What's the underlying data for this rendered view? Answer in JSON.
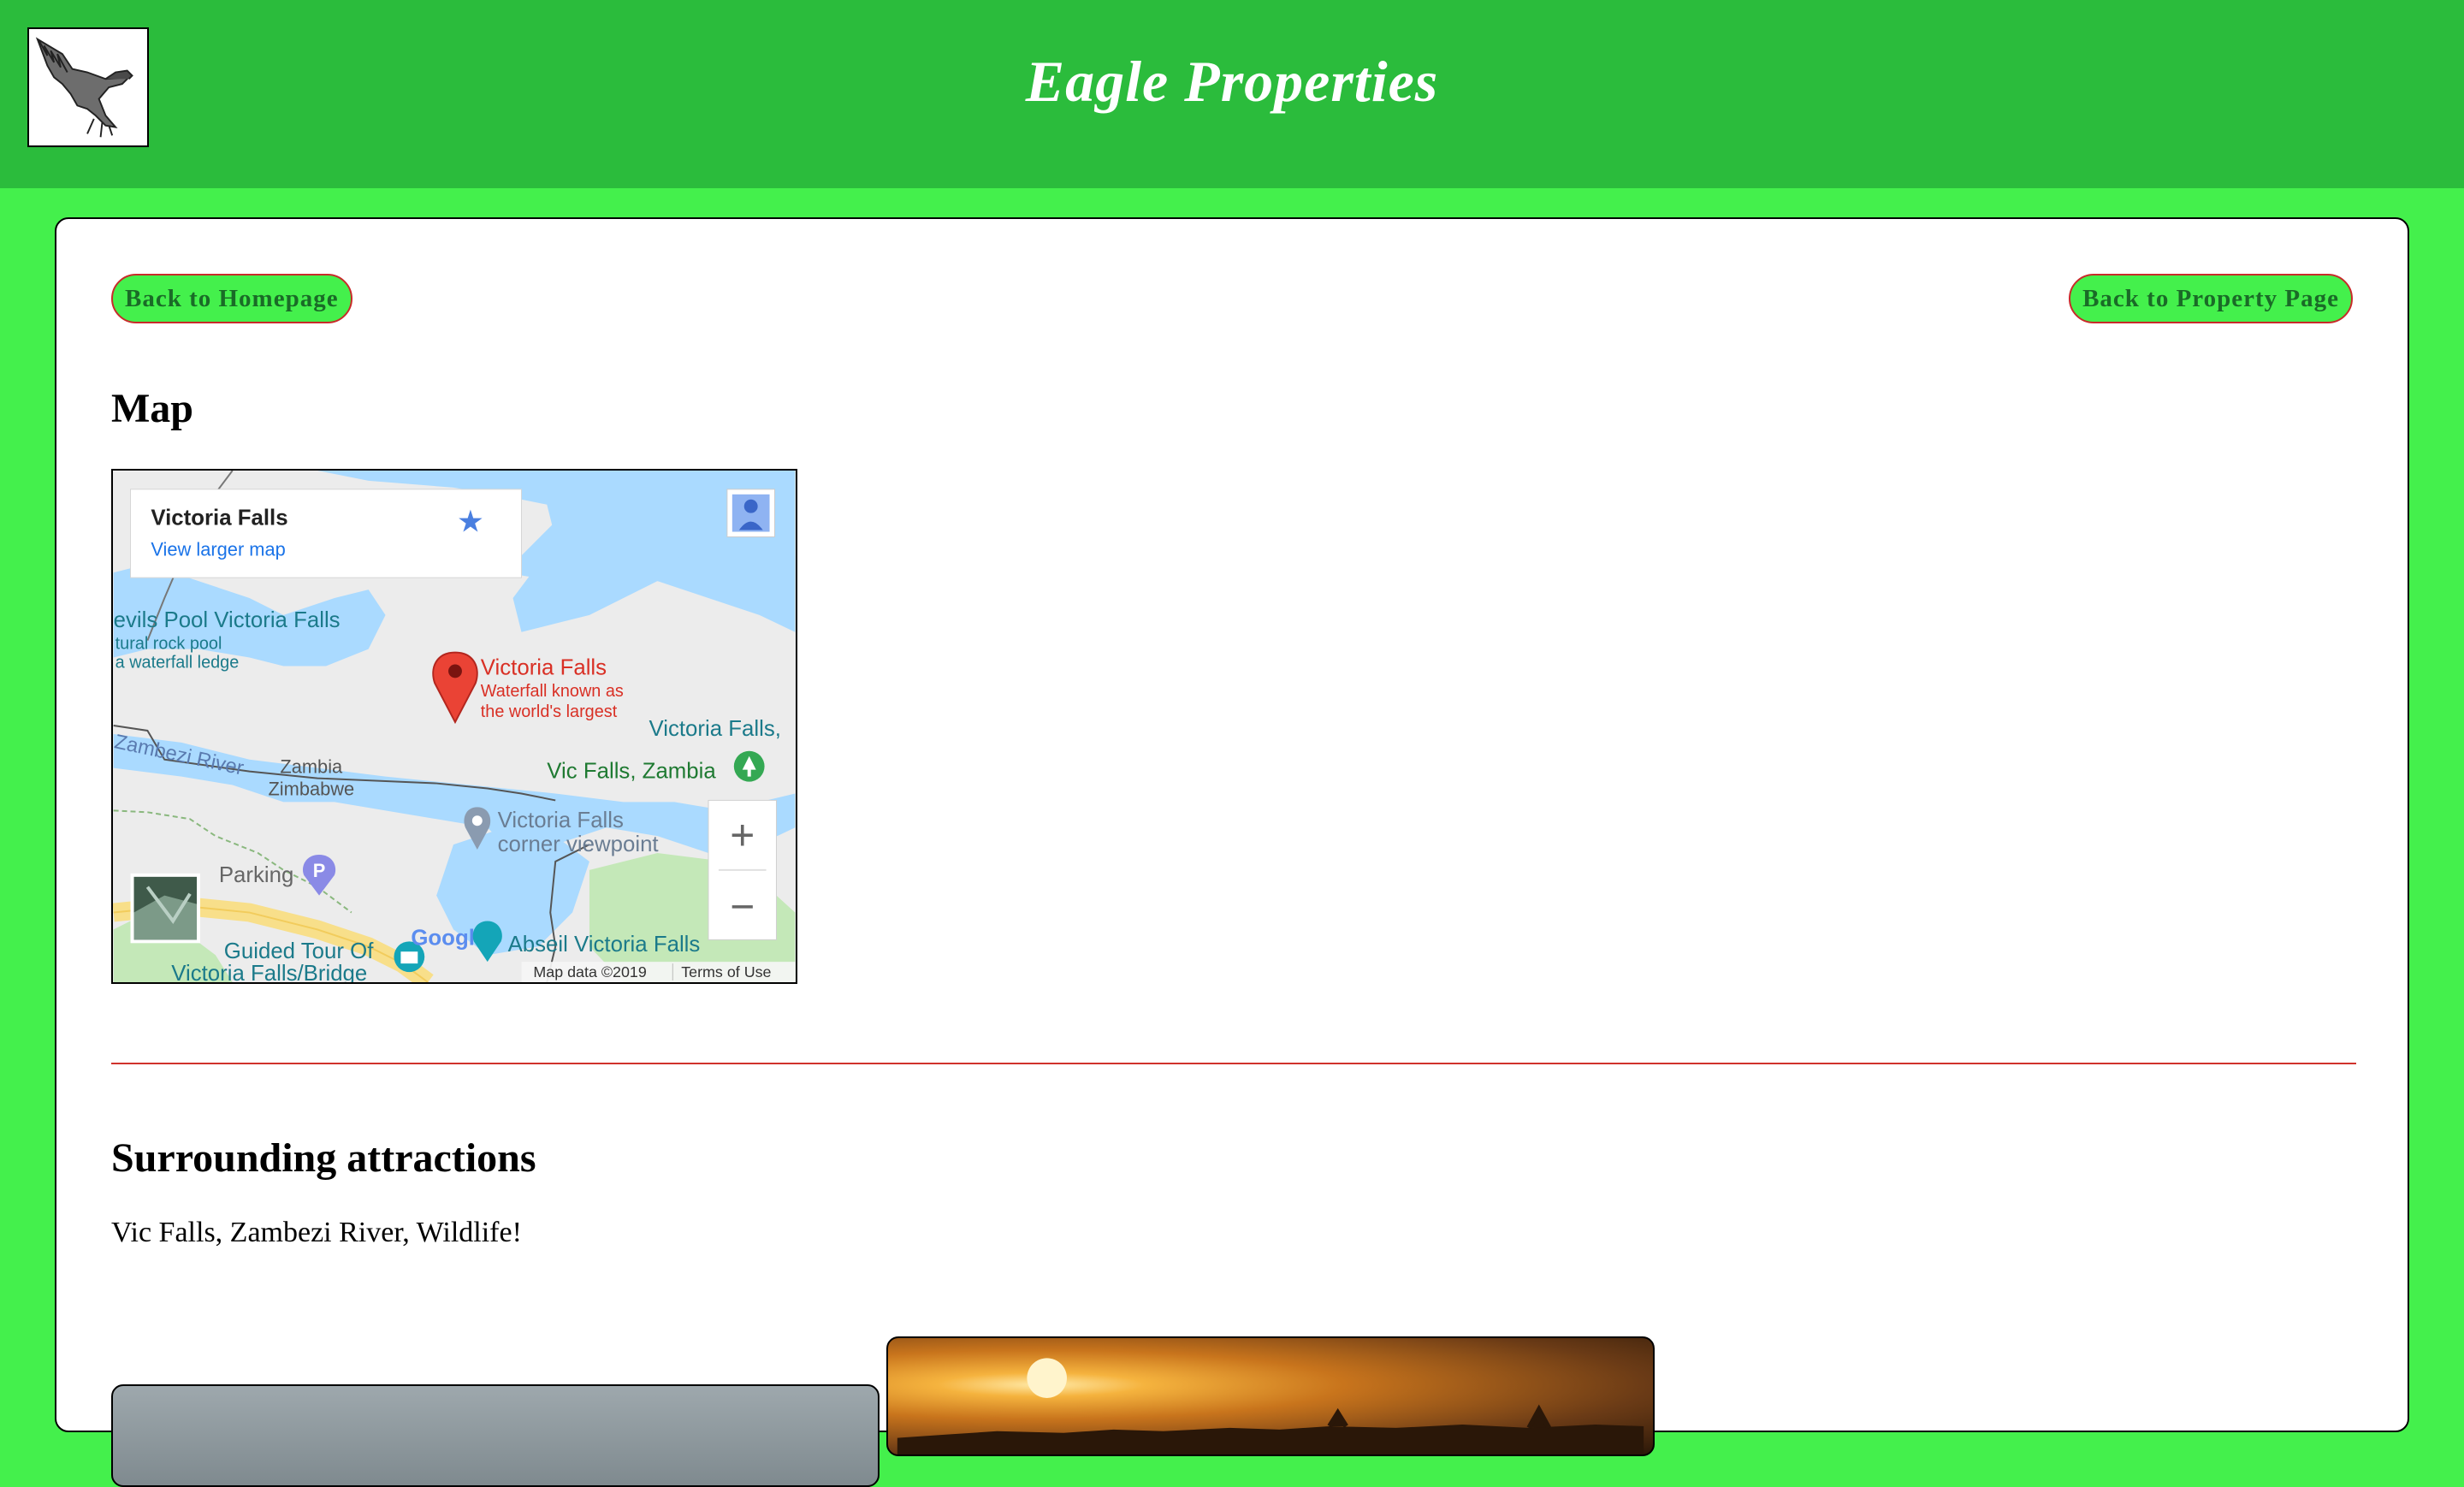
{
  "header": {
    "title": "Eagle Properties",
    "logo_icon": "eagle-logo-icon",
    "background_color": "#2bbc3c"
  },
  "nav": {
    "back_home_label": "Back to Homepage",
    "back_property_label": "Back to Property Page"
  },
  "map_section": {
    "heading": "Map",
    "place_card": {
      "title": "Victoria Falls",
      "link": "View larger map"
    },
    "marker": {
      "title": "Victoria Falls",
      "subtitle_line1": "Waterfall known as",
      "subtitle_line2": "the world's largest"
    },
    "labels": {
      "devils_pool": "evils Pool Victoria Falls",
      "rock_pool_1": "tural rock pool",
      "rock_pool_2": "a waterfall ledge",
      "victoria_falls_right": "Victoria Falls,",
      "vic_falls_zambia": "Vic Falls, Zambia",
      "zambia": "Zambia",
      "zimbabwe": "Zimbabwe",
      "zambezi_river": "Zambezi River",
      "corner_viewpoint_1": "Victoria Falls",
      "corner_viewpoint_2": "corner viewpoint",
      "parking": "Parking",
      "guided_tour_1": "Guided Tour Of",
      "guided_tour_2": "Victoria Falls/Bridge",
      "abseil": "Abseil Victoria Falls",
      "google": "Google",
      "map_data": "Map data ©2019",
      "terms": "Terms of Use",
      "zoom_in": "+",
      "zoom_out": "−"
    }
  },
  "attractions_section": {
    "heading": "Surrounding attractions",
    "text": "Vic Falls, Zambezi River, Wildlife!"
  },
  "colors": {
    "page_background": "#44f04c",
    "button_border": "#c82a2a",
    "button_text": "#1a6b27",
    "divider": "#d0322c"
  }
}
